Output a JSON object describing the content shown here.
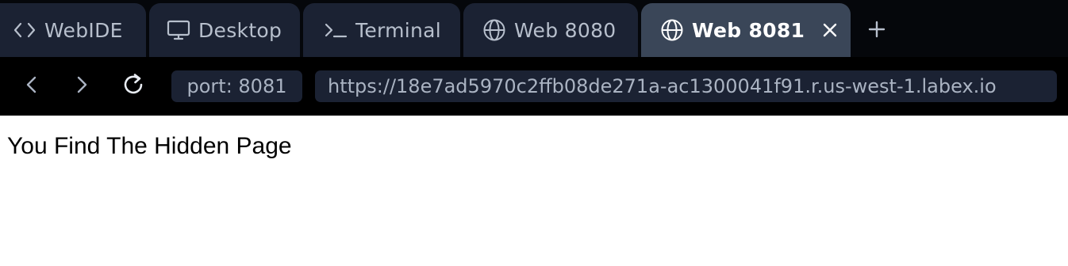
{
  "tabs": [
    {
      "label": "WebIDE",
      "icon": "code-brackets-icon",
      "active": false
    },
    {
      "label": "Desktop",
      "icon": "monitor-icon",
      "active": false
    },
    {
      "label": "Terminal",
      "icon": "terminal-prompt-icon",
      "active": false
    },
    {
      "label": "Web 8080",
      "icon": "globe-icon",
      "active": false
    },
    {
      "label": "Web 8081",
      "icon": "globe-icon",
      "active": true
    }
  ],
  "toolbar": {
    "back_icon": "chevron-left-icon",
    "forward_icon": "chevron-right-icon",
    "reload_icon": "reload-icon",
    "add_tab_icon": "plus-icon",
    "close_tab_icon": "close-icon"
  },
  "address": {
    "port_label": "port: 8081",
    "url": "https://18e7ad5970c2ffb08de271a-ac1300041f91.r.us-west-1.labex.io"
  },
  "page": {
    "heading": "You Find The Hidden Page"
  },
  "colors": {
    "tabbar_bg": "#05070b",
    "tab_bg": "#1b2233",
    "tab_active_bg": "#3a4658",
    "navbar_bg": "#000000",
    "field_bg": "#1b2233",
    "text_muted": "#b7bfcc"
  }
}
